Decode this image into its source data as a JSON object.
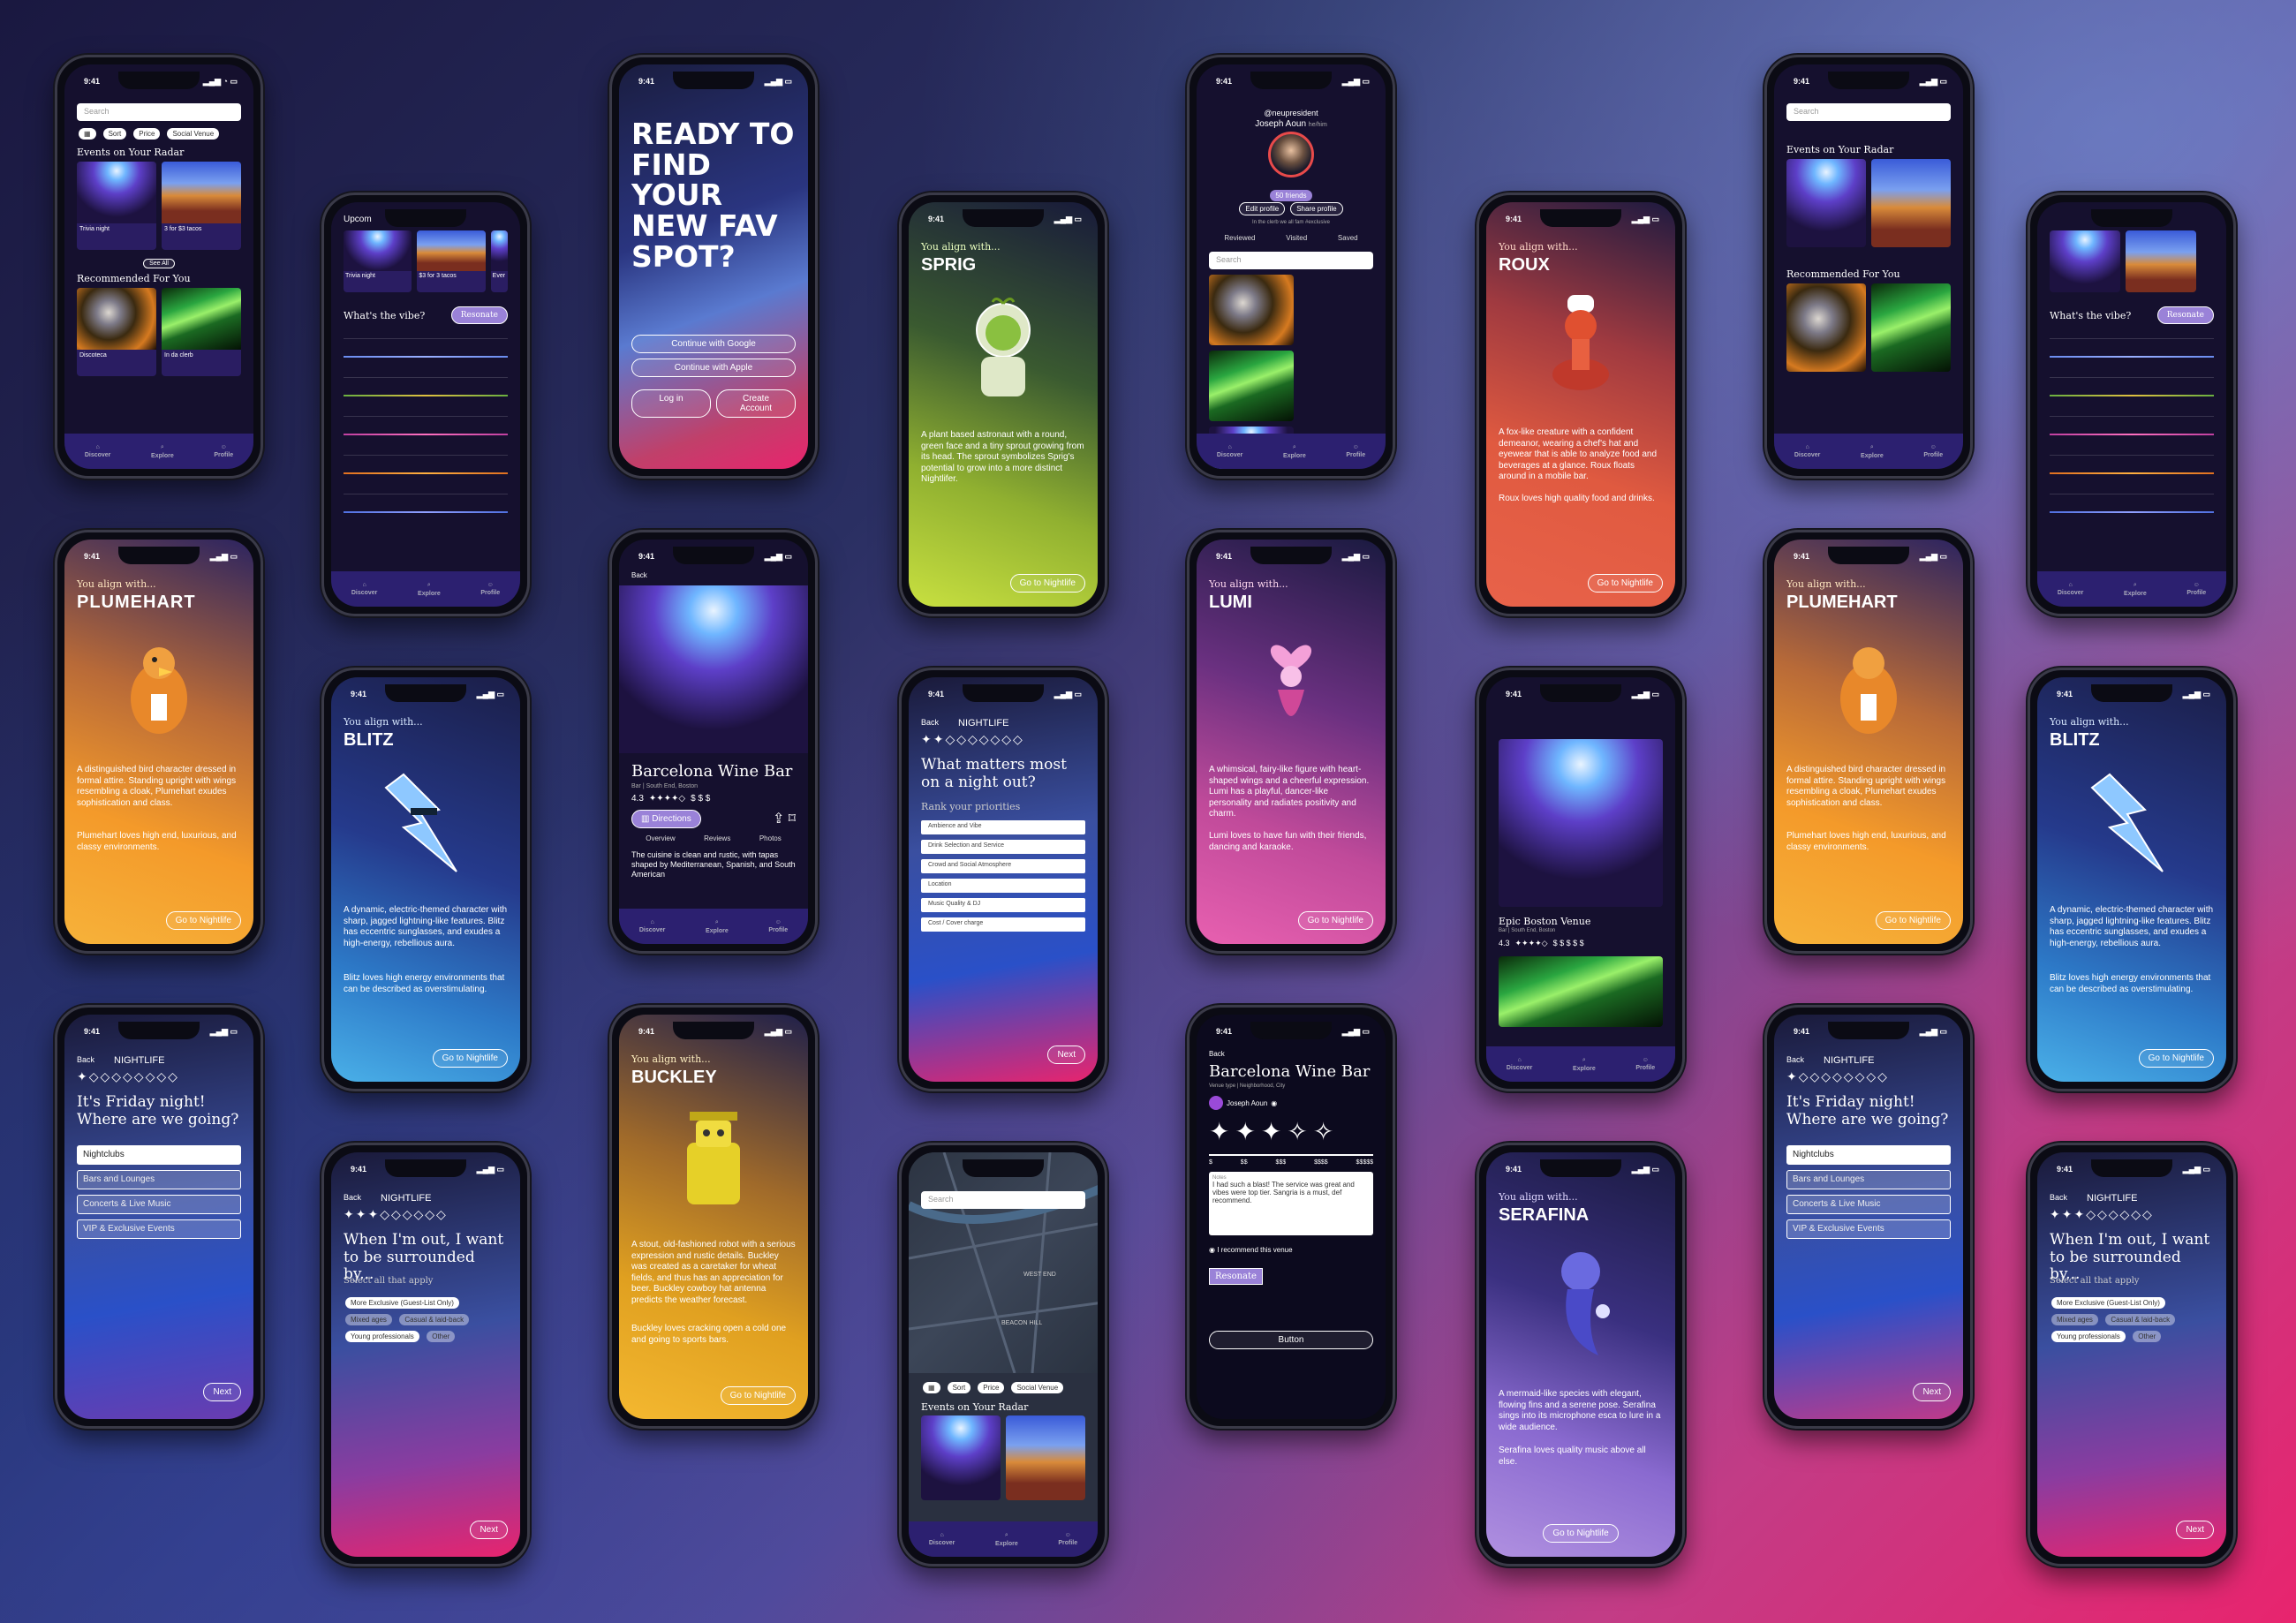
{
  "status_time": "9:41",
  "colors": {
    "accent": "#8e6bd8",
    "nav": "#2c2070",
    "bg_pink": "#e8246e"
  },
  "discover": {
    "search_placeholder": "Search",
    "filters": [
      "Sort",
      "Price",
      "Social Venue"
    ],
    "radar_title": "Events on Your Radar",
    "radar_items": [
      {
        "name": "Trivia night",
        "date": "12/30/2024, 6-9pm"
      },
      {
        "name": "3 for $3 tacos",
        "date": "12/30/2024, 3-6pm"
      }
    ],
    "see_all": "See All",
    "recommended_title": "Recommended For You",
    "rec_items": [
      {
        "name": "Discoteca",
        "type": "Bar"
      },
      {
        "name": "In da clerb",
        "type": "Club"
      }
    ],
    "nav": [
      "Discover",
      "Explore",
      "Profile"
    ]
  },
  "vibe": {
    "upcoming": "Upcom",
    "radar_items": [
      {
        "name": "Trivia night",
        "date": "12/30/2024, 6-9pm"
      },
      {
        "name": "$3 for 3 tacos",
        "date": "12/30/2024, 3-6pm"
      },
      {
        "name": "Ever",
        "date": "Date"
      }
    ],
    "question": "What's the vibe?",
    "resonate": "Resonate"
  },
  "welcome": {
    "title": "READY TO FIND YOUR NEW FAV SPOT?",
    "google": "Continue with Google",
    "apple": "Continue with Apple",
    "login": "Log in",
    "create": "Create Account"
  },
  "align_prefix": "You align with...",
  "go_nightlife": "Go to Nightlife",
  "characters": {
    "sprig": {
      "name": "SPRIG",
      "desc": "A plant based astronaut with a round, green face and a tiny sprout growing from its head. The sprout symbolizes Sprig's potential to grow into a more distinct Nightlifer."
    },
    "roux": {
      "name": "ROUX",
      "desc": "A fox-like creature with a confident demeanor, wearing a chef's hat and eyewear that is able to analyze food and beverages at a glance. Roux floats around in a mobile bar.",
      "loves": "Roux loves high quality food and drinks."
    },
    "plumehart": {
      "name": "PLUMEHART",
      "desc": "A distinguished bird character dressed in formal attire. Standing upright with wings resembling a cloak, Plumehart exudes sophistication and class.",
      "loves": "Plumehart loves high end, luxurious, and classy environments."
    },
    "blitz": {
      "name": "BLITZ",
      "desc": "A dynamic, electric-themed character with sharp, jagged lightning-like features. Blitz has eccentric sunglasses, and exudes a high-energy, rebellious aura.",
      "loves": "Blitz loves high energy environments that can be described as overstimulating."
    },
    "lumi": {
      "name": "LUMI",
      "desc": "A whimsical, fairy-like figure with heart-shaped wings and a cheerful expression. Lumi has a playful, dancer-like personality and radiates positivity and charm.",
      "loves": "Lumi loves to have fun with their friends, dancing and karaoke."
    },
    "buckley": {
      "name": "BUCKLEY",
      "desc": "A stout, old-fashioned robot with a serious expression and rustic details. Buckley was created as a caretaker for wheat fields, and thus has an appreciation for beer. Buckley cowboy hat antenna predicts the weather forecast.",
      "loves": "Buckley loves cracking open a cold one and going to sports bars."
    },
    "serafina": {
      "name": "SERAFINA",
      "desc": "A mermaid-like species with elegant, flowing fins and a serene pose. Serafina sings into its microphone esca to lure in a wide audience.",
      "loves": "Serafina loves quality music above all else."
    }
  },
  "profile": {
    "handle": "@neupresident",
    "name": "Joseph Aoun",
    "pronouns": "he/him",
    "friends": "50 friends",
    "edit": "Edit profile",
    "share": "Share profile",
    "bio": "In the clerb we all fam #exclusive",
    "tabs": [
      "Reviewed",
      "Visited",
      "Saved"
    ],
    "search": "Search"
  },
  "venue": {
    "back": "Back",
    "name": "Barcelona Wine Bar",
    "sub": "Bar | South End, Boston",
    "rating": "4.3",
    "price": "$ $ $",
    "directions": "Directions",
    "tabs": [
      "Overview",
      "Reviews",
      "Photos"
    ],
    "desc": "The cuisine is clean and rustic, with tapas shaped by Mediterranean, Spanish, and South American"
  },
  "priorities": {
    "back": "Back",
    "header": "NIGHTLIFE",
    "question": "What matters most on a night out?",
    "sub": "Rank your priorities",
    "items": [
      "Ambience and Vibe",
      "Drink Selection and Service",
      "Crowd and Social Atmosphere",
      "Location",
      "Music Quality & DJ",
      "Cost / Cover charge"
    ],
    "next": "Next"
  },
  "friday": {
    "back": "Back",
    "header": "NIGHTLIFE",
    "question": "It's Friday night! Where are we going?",
    "options": [
      "Nightclubs",
      "Bars and Lounges",
      "Concerts & Live Music",
      "VIP & Exclusive Events"
    ],
    "next": "Next"
  },
  "surround": {
    "back": "Back",
    "header": "NIGHTLIFE",
    "question": "When I'm out, I want to be surrounded by...",
    "sub": "Select all that apply",
    "chips": [
      "More Exclusive (Guest-List Only)",
      "Mixed ages",
      "Casual & laid-back",
      "Young professionals",
      "Other"
    ],
    "next": "Next"
  },
  "epic": {
    "name": "Epic Boston Venue",
    "sub": "Bar | South End, Boston",
    "rating": "4.3",
    "price": "$ $ $ $ $"
  },
  "review": {
    "back": "Back",
    "name": "Barcelona Wine Bar",
    "sub": "Venue type | Neighborhood, City",
    "user": "Joseph Aoun",
    "scale": [
      "$",
      "$$",
      "$$$",
      "$$$$",
      "$$$$$"
    ],
    "notes_label": "Notes",
    "notes": "I had such a blast! The service was great and vibes were top tier. Sangria is a must, def recommend.",
    "recommend": "I recommend this venue",
    "resonate": "Resonate",
    "button": "Button"
  },
  "map": {
    "search": "Search",
    "filters": [
      "Sort",
      "Price",
      "Social Venue"
    ],
    "areas": [
      "WEST END",
      "BEACON HILL"
    ],
    "radar_title": "Events on Your Radar"
  }
}
